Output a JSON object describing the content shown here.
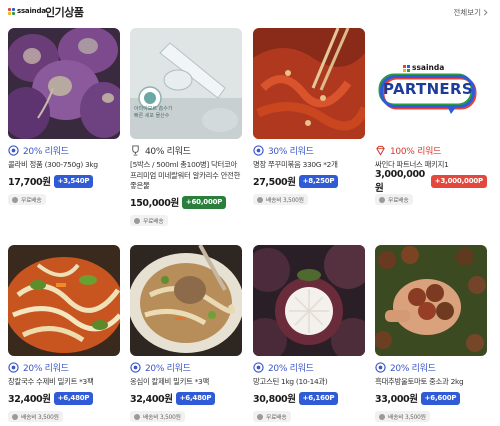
{
  "header": {
    "logo_text": "ssainda",
    "section_title": "인기상품",
    "view_all": "전체보기"
  },
  "colors": {
    "reward_blue": "#3b57c8",
    "reward_red": "#d9372b",
    "badge_blue": "#2f5bd6",
    "badge_green": "#2a7f3c",
    "badge_red": "#e2483c"
  },
  "products": [
    {
      "reward": "20% 리워드",
      "title": "콜라비 정품 (300-750g) 3kg",
      "price": "17,700원",
      "badge": "+3,540P",
      "shipping": "무료배송",
      "image_overlay": ""
    },
    {
      "reward": "40% 리워드",
      "title": "[5박스 / 500ml 총100병] 닥터코아 프리미엄 미네랄워터 알카리수 안전한 좋은물",
      "price": "150,000원",
      "badge": "+60,000P",
      "shipping": "무료배송",
      "image_overlay": "아미아모르 흡수가 빠른 세포 물산수"
    },
    {
      "reward": "30% 리워드",
      "title": "명장 쭈꾸미볶음 330G *2개",
      "price": "27,500원",
      "badge": "+8,250P",
      "shipping": "배송비 3,500원",
      "image_overlay": ""
    },
    {
      "reward": "100% 리워드",
      "title": "싸인다 파트너스 패키지1",
      "price": "3,000,000원",
      "badge": "+3,000,000P",
      "shipping": "무료배송",
      "image_brand": "ssainda",
      "image_word": "PARTNERS"
    },
    {
      "reward": "20% 리워드",
      "title": "장칼국수 수제비 밀키트 *3팩",
      "price": "32,400원",
      "badge": "+6,480P",
      "shipping": "배송비 3,500원"
    },
    {
      "reward": "20% 리워드",
      "title": "옹심이 칼제비 밀키트 *3팩",
      "price": "32,400원",
      "badge": "+6,480P",
      "shipping": "배송비 3,500원"
    },
    {
      "reward": "20% 리워드",
      "title": "망고스틴 1kg (10-14과)",
      "price": "30,800원",
      "badge": "+6,160P",
      "shipping": "무료배송"
    },
    {
      "reward": "20% 리워드",
      "title": "흑대추방울토마토 중소과 2kg",
      "price": "33,000원",
      "badge": "+6,600P",
      "shipping": "배송비 3,500원"
    }
  ]
}
